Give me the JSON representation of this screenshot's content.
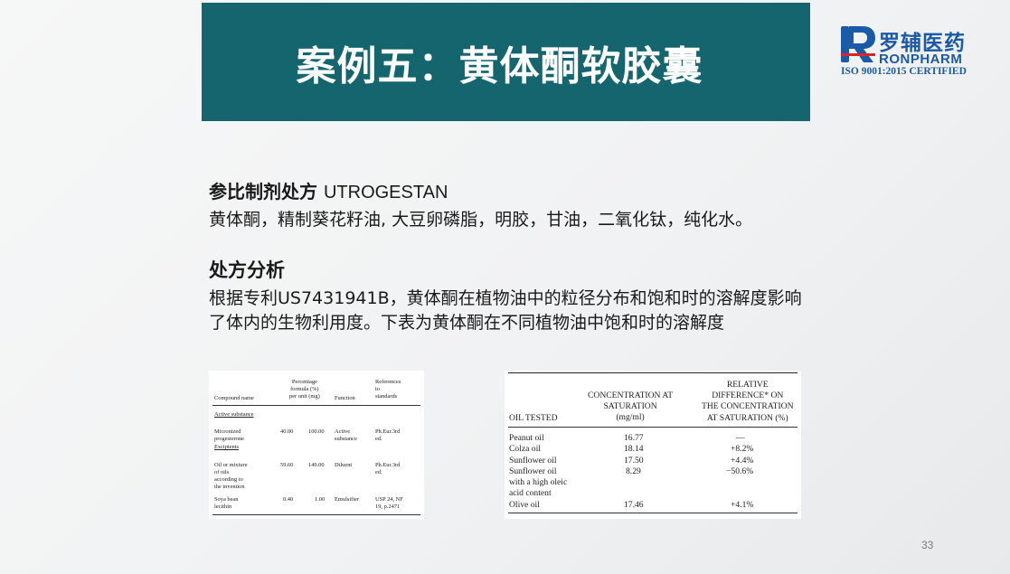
{
  "slide": {
    "title": "案例五：黄体酮软胶囊",
    "page_number": "33"
  },
  "logo": {
    "name_cn": "罗辅医药",
    "name_en": "RONPHARM",
    "certification": "ISO 9001:2015 CERTIFIED",
    "brand_color": "#1b5aa6"
  },
  "content": {
    "heading1_cn": "参比制剂处方",
    "heading1_latin": "UTROGESTAN",
    "formula_text": "黄体酮，精制葵花籽油, 大豆卵磷脂，明胶，甘油，二氧化钛，纯化水。",
    "heading2": "处方分析",
    "analysis_text": "根据专利US7431941B，黄体酮在植物油中的粒径分布和饱和时的溶解度影响了体内的生物利用度。下表为黄体酮在不同植物油中饱和时的溶解度"
  },
  "table_formula": {
    "headers": {
      "compound": "Compound name",
      "percentage": "Percentage\nformula (%)\nper unit (mg)",
      "function": "Function",
      "references": "References\nto\nstandards"
    },
    "section_active": "Active substance",
    "row_progesterone": {
      "name": "Micronized\nprogesterone",
      "percent": "40.00",
      "mg": "100.00",
      "function": "Active\nsubstance",
      "reference": "Ph.Eur.3rd\ned."
    },
    "section_excipients": "Excipients",
    "row_oil": {
      "name": "Oil or mixture\nof oils\naccording to\nthe invention",
      "percent": "59.60",
      "mg": "149.00",
      "function": "Diluent",
      "reference": "Ph.Eur.3rd\ned."
    },
    "row_lecithin": {
      "name": "Soya bean\nlecithin",
      "percent": "0.40",
      "mg": "1.00",
      "function": "Emulsifier",
      "reference": "USP 24, NF\n19, p.2471"
    }
  },
  "table_solubility": {
    "headers": {
      "oil": "OIL TESTED",
      "concentration": "CONCENTRATION AT\nSATURATION\n(mg/ml)",
      "difference": "RELATIVE\nDIFFERENCE* ON\nTHE CONCENTRATION\nAT SATURATION (%)"
    },
    "rows": [
      {
        "oil": "Peanut oil",
        "concentration": "16.77",
        "difference": "—"
      },
      {
        "oil": "Colza oil",
        "concentration": "18.14",
        "difference": "+8.2%"
      },
      {
        "oil": "Sunflower oil",
        "concentration": "17.50",
        "difference": "+4.4%"
      },
      {
        "oil": "Sunflower oil\nwith a high oleic\nacid content",
        "concentration": "8.29",
        "difference": "−50.6%"
      },
      {
        "oil": "Olive oil",
        "concentration": "17.46",
        "difference": "+4.1%"
      }
    ]
  },
  "colors": {
    "title_bar": "#15656f",
    "title_text": "#ffffff",
    "body_text": "#1a1a1a"
  }
}
